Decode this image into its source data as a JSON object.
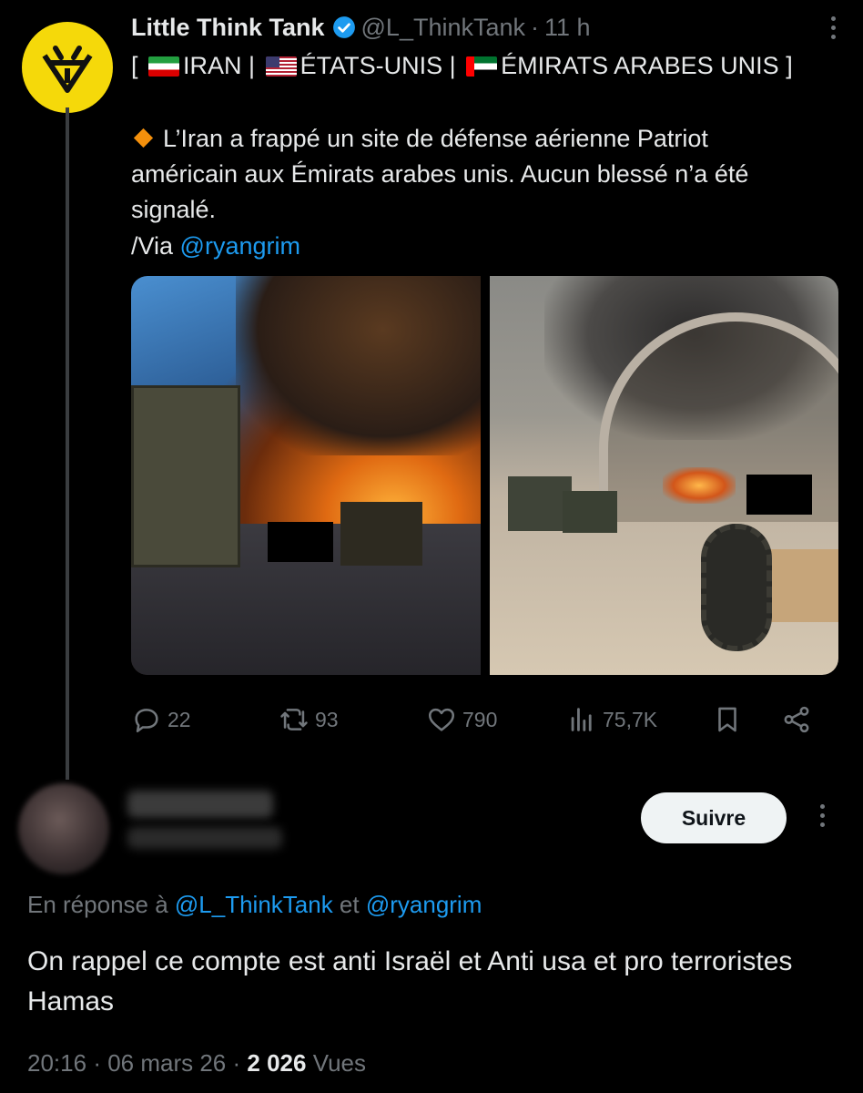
{
  "tweet": {
    "display_name": "Little Think Tank",
    "handle": "@L_ThinkTank",
    "time": "11 h",
    "tags": {
      "open": "[",
      "iran": "IRAN |",
      "usa": "ÉTATS-UNIS |",
      "uae": "ÉMIRATS ARABES UNIS ]"
    },
    "body_line1": "L’Iran a frappé un site de défense aérienne Patriot",
    "body_line2": "américain aux Émirats arabes unis. Aucun blessé n’a été",
    "body_line3": "signalé.",
    "via_prefix": "/Via ",
    "via_mention": "@ryangrim",
    "stats": {
      "replies": "22",
      "retweets": "93",
      "likes": "790",
      "views": "75,7K"
    }
  },
  "reply": {
    "follow_label": "Suivre",
    "reply_to_prefix": "En réponse à ",
    "reply_to_user1": "@L_ThinkTank",
    "reply_to_and": " et ",
    "reply_to_user2": "@ryangrim",
    "body": "On rappel ce compte est anti Israël et Anti usa et pro terroristes Hamas",
    "time": "20:16",
    "date": "06 mars 26",
    "views_count": "2 026",
    "views_label": "Vues"
  }
}
